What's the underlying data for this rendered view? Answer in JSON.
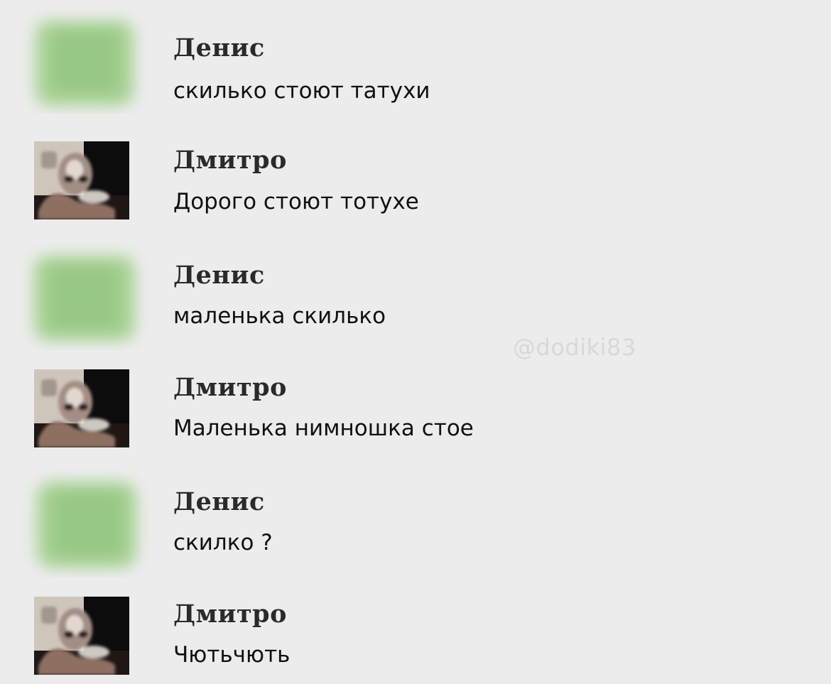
{
  "conversation": {
    "messages": [
      {
        "sender": "Денис",
        "text": "скилько стоют татухи",
        "avatar": "blurred-green-avatar"
      },
      {
        "sender": "Дмитро",
        "text": "Дорого стоют тотухе",
        "avatar": "dark-photo-avatar"
      },
      {
        "sender": "Денис",
        "text": "маленька скилько",
        "avatar": "blurred-green-avatar"
      },
      {
        "sender": "Дмитро",
        "text": "Маленька нимношка стое",
        "avatar": "dark-photo-avatar"
      },
      {
        "sender": "Денис",
        "text": "скилко ?",
        "avatar": "blurred-green-avatar"
      },
      {
        "sender": "Дмитро",
        "text": "Чютьчють",
        "avatar": "dark-photo-avatar"
      }
    ]
  },
  "watermark": "@dodiki83",
  "colors": {
    "background": "#ececec",
    "blurred_avatar": "#9fcf8d",
    "sender_name": "#2a2a2a",
    "message_text": "#111111"
  }
}
